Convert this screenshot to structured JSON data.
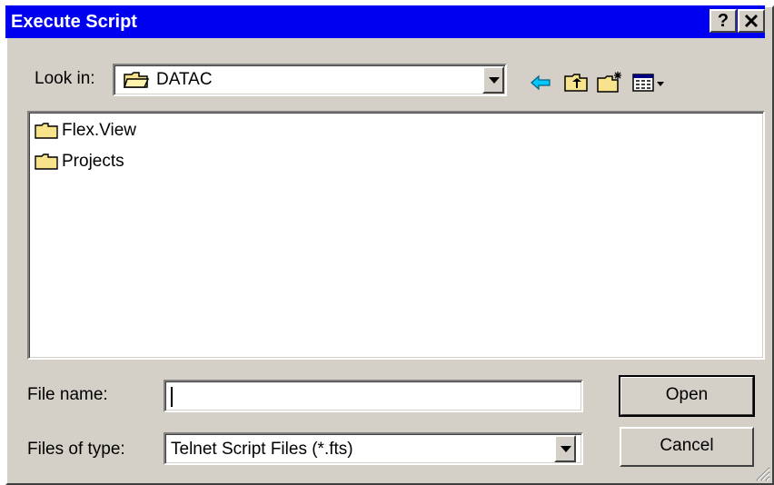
{
  "window": {
    "title": "Execute Script",
    "help_label": "?",
    "close_label": "✕"
  },
  "look_in": {
    "label": "Look in:",
    "value": "DATAC"
  },
  "toolbar": {
    "icons": [
      "back-icon",
      "up-folder-icon",
      "new-folder-icon",
      "view-menu-icon"
    ]
  },
  "files": [
    {
      "name": "Flex.View"
    },
    {
      "name": "Projects"
    }
  ],
  "file_name": {
    "label": "File name:",
    "value": ""
  },
  "file_type": {
    "label": "Files of type:",
    "value": "Telnet Script Files (*.fts)"
  },
  "buttons": {
    "open": "Open",
    "cancel": "Cancel"
  }
}
